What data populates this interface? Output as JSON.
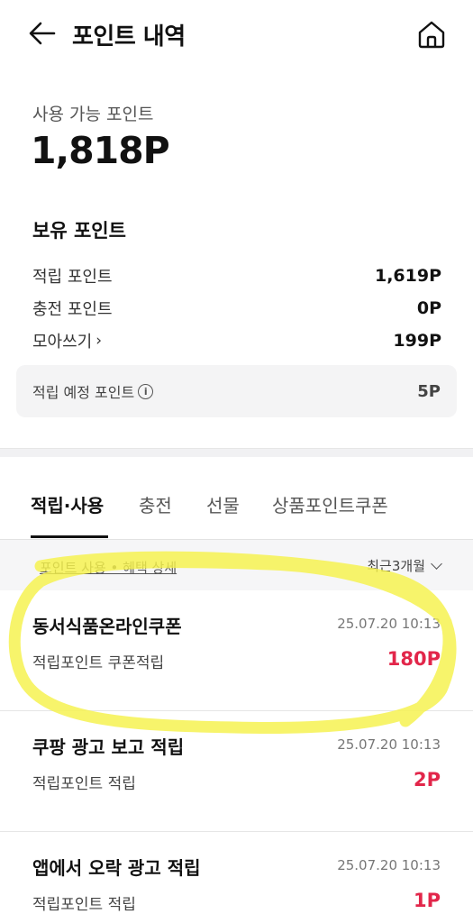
{
  "header": {
    "title": "포인트 내역",
    "back_icon": "arrow-left-icon",
    "home_icon": "home-icon"
  },
  "available": {
    "label": "사용 가능 포인트",
    "amount": "1,818P"
  },
  "held": {
    "title": "보유 포인트",
    "rows": [
      {
        "label": "적립 포인트",
        "value": "1,619P"
      },
      {
        "label": "충전 포인트",
        "value": "0P"
      },
      {
        "label": "모아쓰기",
        "value": "199P"
      }
    ],
    "expected": {
      "label": "적립 예정 포인트",
      "value": "5P"
    }
  },
  "tabs": [
    "적립·사용",
    "충전",
    "선물",
    "상품포인트쿠폰"
  ],
  "filter": {
    "link": "포인트 사용 • 혜택 상세",
    "period": "최근3개월"
  },
  "transactions": [
    {
      "title": "동서식품온라인쿠폰",
      "date": "25.07.20 10:13",
      "type": "적립포인트 쿠폰적립",
      "amount": "180P"
    },
    {
      "title": "쿠팡 광고 보고 적립",
      "date": "25.07.20 10:13",
      "type": "적립포인트 적립",
      "amount": "2P"
    },
    {
      "title": "앱에서 오락 광고 적립",
      "date": "25.07.20 10:13",
      "type": "적립포인트 적립",
      "amount": "1P"
    }
  ],
  "colors": {
    "accent": "#e2264a",
    "highlight": "#f5f24a"
  }
}
